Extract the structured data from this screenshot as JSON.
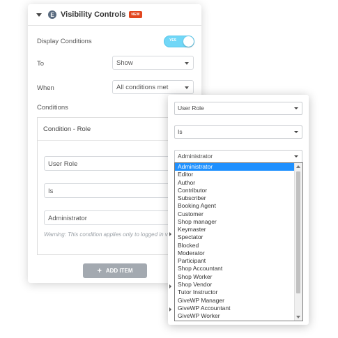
{
  "panel": {
    "title": "Visibility Controls",
    "badge": "NEW",
    "icon": "ea-icon",
    "display_conditions_label": "Display Conditions",
    "toggle_text": "YES",
    "to_label": "To",
    "to_value": "Show",
    "when_label": "When",
    "when_value": "All conditions met",
    "conditions_label": "Conditions",
    "condition_title": "Condition - Role",
    "field1": "User Role",
    "field2": "Is",
    "field3": "Administrator",
    "warning": "Warning: This condition applies only to logged in visitors.",
    "add_item": "ADD ITEM"
  },
  "overlay": {
    "select1": "User Role",
    "select2": "Is",
    "select3": "Administrator",
    "options": [
      "Administrator",
      "Editor",
      "Author",
      "Contributor",
      "Subscriber",
      "Booking Agent",
      "Customer",
      "Shop manager",
      "Keymaster",
      "Spectator",
      "Blocked",
      "Moderator",
      "Participant",
      "Shop Accountant",
      "Shop Worker",
      "Shop Vendor",
      "Tutor Instructor",
      "GiveWP Manager",
      "GiveWP Accountant",
      "GiveWP Worker"
    ],
    "selected_index": 0
  },
  "colors": {
    "toggle": "#71d7f7",
    "badge": "#e2461f",
    "selected": "#1e90ff",
    "button": "#a3a9b0"
  }
}
